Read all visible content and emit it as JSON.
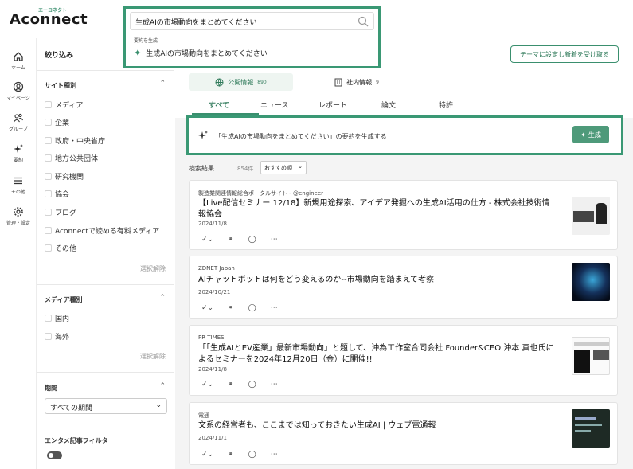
{
  "brand": {
    "name": "Aconnect",
    "tagline": "エーコネクト",
    "accent": "#3a8f6e"
  },
  "search": {
    "value": "生成AIの市場動向をまとめてください",
    "suggest_label": "要約を生成",
    "suggest_item": "生成AIの市場動向をまとめてください"
  },
  "rail": [
    {
      "label": "ホーム",
      "icon": "home-icon"
    },
    {
      "label": "マイページ",
      "icon": "user-icon"
    },
    {
      "label": "グループ",
      "icon": "group-icon"
    },
    {
      "label": "要約",
      "icon": "sparkle-icon"
    },
    {
      "label": "その他",
      "icon": "menu-icon"
    },
    {
      "label": "管理・設定",
      "icon": "gear-icon"
    }
  ],
  "filter": {
    "title": "絞り込み",
    "site_type": {
      "heading": "サイト種別",
      "items": [
        "メディア",
        "企業",
        "政府・中央省庁",
        "地方公共団体",
        "研究機関",
        "協会",
        "ブログ",
        "Aconnectで読める有料メディア",
        "その他"
      ],
      "clear": "選択解除"
    },
    "media_type": {
      "heading": "メディア種別",
      "items": [
        "国内",
        "海外"
      ],
      "clear": "選択解除"
    },
    "period": {
      "heading": "期間",
      "value": "すべての期間"
    },
    "entertainment": {
      "heading": "エンタメ記事フィルタ",
      "enabled": true
    }
  },
  "main": {
    "subscribe_button": "テーマに設定し新着を受け取る",
    "segments": [
      {
        "label": "公開情報",
        "count": "890"
      },
      {
        "label": "社内情報",
        "count": "9"
      }
    ],
    "tabs": [
      "すべて",
      "ニュース",
      "レポート",
      "論文",
      "特許"
    ],
    "generate": {
      "text": "「生成AIの市場動向をまとめてください」の要約を生成する",
      "button": "生成"
    },
    "results": {
      "label": "検索結果",
      "count": "854件",
      "sort": "おすすめ順"
    },
    "cards": [
      {
        "source": "製造業関連情報総合ポータルサイト - @engineer",
        "title": "【Live配信セミナー 12/18】新規用途探索、アイデア発掘への生成AI活用の仕方 - 株式会社技術情報協会",
        "date": "2024/11/8"
      },
      {
        "source": "ZDNET Japan",
        "title": "AIチャットボットは何をどう変えるのか--市場動向を踏まえて考察",
        "date": "2024/10/21"
      },
      {
        "source": "PR TIMES",
        "title": "「「生成AIとEV産業」最新市場動向」と題して、沖為工作室合同会社 Founder&CEO 沖本 真也氏によるセミナーを2024年12月20日（金）に開催!!",
        "date": "2024/11/8"
      },
      {
        "source": "電通",
        "title": "文系の経営者も、ここまでは知っておきたい生成AI | ウェブ電通報",
        "date": "2024/11/1"
      }
    ]
  }
}
